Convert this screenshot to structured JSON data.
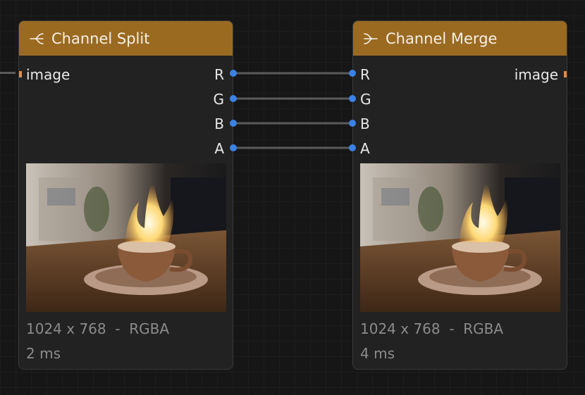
{
  "nodes": {
    "split": {
      "title": "Channel Split",
      "icon": "split-icon",
      "input_label": "image",
      "outputs": [
        "R",
        "G",
        "B",
        "A"
      ],
      "dims": "1024 x 768  -  RGBA",
      "time": "2 ms"
    },
    "merge": {
      "title": "Channel Merge",
      "icon": "merge-icon",
      "inputs": [
        "R",
        "G",
        "B",
        "A"
      ],
      "output_label": "image",
      "dims": "1024 x 768  -  RGBA",
      "time": "4 ms"
    }
  },
  "colors": {
    "header": "#9a6a21",
    "socket_image": "#e88b3d",
    "socket_channel": "#3b82e6",
    "wire": "#5a5a5a"
  }
}
